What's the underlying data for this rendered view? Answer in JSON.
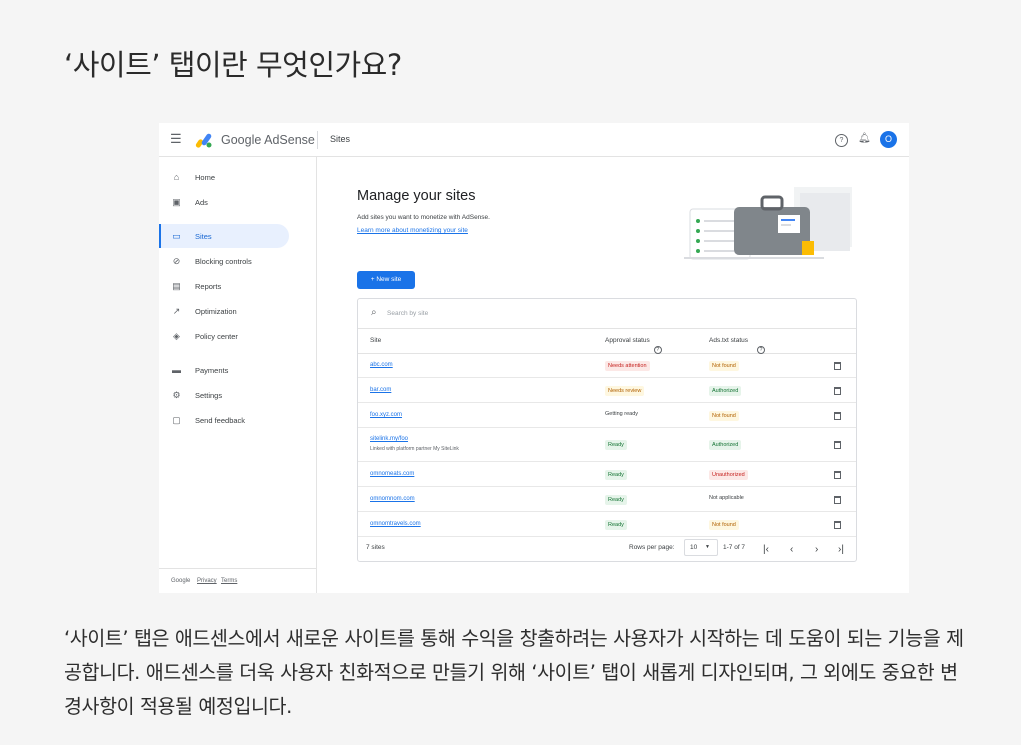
{
  "heading": "‘사이트’ 탭이란 무엇인가요?",
  "body_text": "‘사이트’ 탭은 애드센스에서 새로운 사이트를 통해 수익을 창출하려는 사용자가 시작하는 데 도움이 되는 기능을 제공합니다. 애드센스를 더욱 사용자 친화적으로 만들기 위해 ‘사이트’ 탭이 새롭게 디자인되며, 그 외에도 중요한 변경사항이 적용될 예정입니다.",
  "screenshot": {
    "topbar": {
      "brand_google": "Google",
      "brand_product": "AdSense",
      "breadcrumb": "Sites",
      "avatar_initial": "O"
    },
    "sidebar": {
      "items": [
        {
          "icon": "home-icon",
          "glyph": "⌂",
          "label": "Home",
          "active": false
        },
        {
          "icon": "ads-icon",
          "glyph": "▣",
          "label": "Ads",
          "active": false
        },
        {
          "icon": "sites-icon",
          "glyph": "▭",
          "label": "Sites",
          "active": true
        },
        {
          "icon": "blocking-icon",
          "glyph": "⊘",
          "label": "Blocking controls",
          "active": false
        },
        {
          "icon": "reports-icon",
          "glyph": "▤",
          "label": "Reports",
          "active": false
        },
        {
          "icon": "optimization-icon",
          "glyph": "↗",
          "label": "Optimization",
          "active": false
        },
        {
          "icon": "policy-icon",
          "glyph": "◈",
          "label": "Policy center",
          "active": false
        },
        {
          "icon": "payments-icon",
          "glyph": "▬",
          "label": "Payments",
          "active": false
        },
        {
          "icon": "settings-icon",
          "glyph": "⚙",
          "label": "Settings",
          "active": false
        },
        {
          "icon": "feedback-icon",
          "glyph": "▢",
          "label": "Send feedback",
          "active": false
        }
      ],
      "footer": {
        "google": "Google",
        "privacy": "Privacy",
        "terms": "Terms"
      }
    },
    "main": {
      "title": "Manage your sites",
      "description": "Add sites you want to monetize with AdSense.",
      "learn_more": "Learn more about monetizing your site",
      "new_site_button": "+  New site"
    },
    "table": {
      "search_placeholder": "Search by site",
      "columns": [
        "Site",
        "Approval status",
        "Ads.txt status"
      ],
      "rows": [
        {
          "site": "abc.com",
          "sub": "",
          "approval": "Needs attention",
          "approval_style": "red",
          "adstxt": "Not found",
          "adstxt_style": "yellow"
        },
        {
          "site": "bar.com",
          "sub": "",
          "approval": "Needs review",
          "approval_style": "yellow",
          "adstxt": "Authorized",
          "adstxt_style": "green"
        },
        {
          "site": "foo.xyz.com",
          "sub": "",
          "approval": "Getting ready",
          "approval_style": "plain",
          "adstxt": "Not found",
          "adstxt_style": "yellow"
        },
        {
          "site": "sitelink.my/foo",
          "sub": "Linked with platform partner My SiteLink",
          "approval": "Ready",
          "approval_style": "green",
          "adstxt": "Authorized",
          "adstxt_style": "green"
        },
        {
          "site": "omnomeats.com",
          "sub": "",
          "approval": "Ready",
          "approval_style": "green",
          "adstxt": "Unauthorized",
          "adstxt_style": "red"
        },
        {
          "site": "omnomnom.com",
          "sub": "",
          "approval": "Ready",
          "approval_style": "green",
          "adstxt": "Not applicable",
          "adstxt_style": "plain"
        },
        {
          "site": "omnomtravels.com",
          "sub": "",
          "approval": "Ready",
          "approval_style": "green",
          "adstxt": "Not found",
          "adstxt_style": "yellow"
        }
      ],
      "footer": {
        "count": "7 sites",
        "rows_per_page_label": "Rows per page:",
        "rows_per_page_value": "10",
        "range": "1-7 of 7"
      }
    }
  }
}
